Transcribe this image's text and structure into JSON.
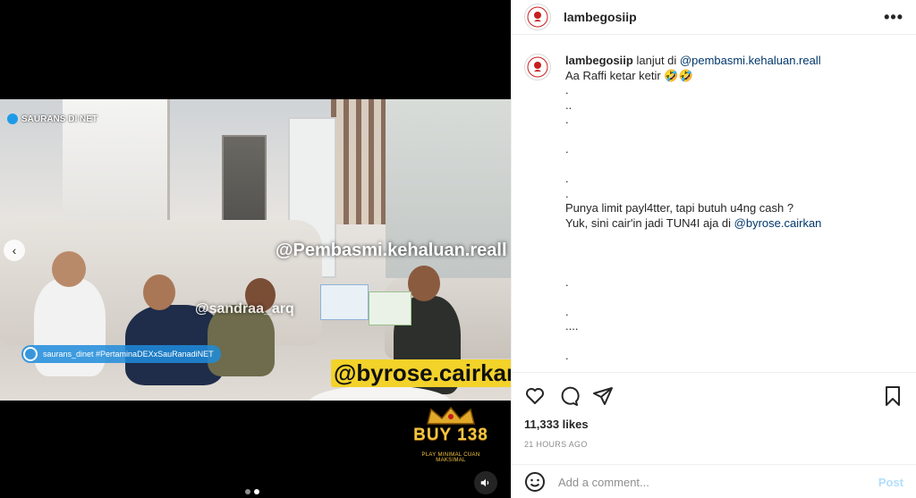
{
  "account": {
    "username": "lambegosiip",
    "more_label": "•••"
  },
  "media": {
    "video": {
      "channel_tag": "SAURANS DI NET",
      "ig_tag": "saurans_dinet #PertaminaDEXxSauRanadiNET",
      "watermark_main": "@Pembasmi.kehaluan.reall",
      "watermark_small": "@sandraa_arq",
      "watermark_promo": "@byrose.cairkan"
    },
    "ad": {
      "brand": "BUY 138",
      "tagline": "PLAY MINIMAL CUAN MAKSIMAL"
    },
    "prev_arrow": "‹",
    "carousel": {
      "count": 2,
      "active": 2
    }
  },
  "caption": {
    "username": "lambegosiip",
    "lines": [
      {
        "pre": "lanjut di ",
        "mention": "@pembasmi.kehaluan.reall",
        "post": ""
      },
      {
        "pre": "Aa Raffi ketar ketir 🤣🤣",
        "mention": "",
        "post": ""
      },
      {
        "pre": ".",
        "mention": "",
        "post": ""
      },
      {
        "pre": "..",
        "mention": "",
        "post": ""
      },
      {
        "pre": ".",
        "mention": "",
        "post": ""
      },
      {
        "pre": "",
        "mention": "",
        "post": ""
      },
      {
        "pre": ".",
        "mention": "",
        "post": ""
      },
      {
        "pre": "",
        "mention": "",
        "post": ""
      },
      {
        "pre": ".",
        "mention": "",
        "post": ""
      },
      {
        "pre": ".",
        "mention": "",
        "post": ""
      },
      {
        "pre": "Punya limit payl4tter, tapi butuh u4ng cash ?",
        "mention": "",
        "post": ""
      },
      {
        "pre": "Yuk, sini cair'in jadi TUN4I aja di ",
        "mention": "@byrose.cairkan",
        "post": ""
      },
      {
        "pre": "",
        "mention": "",
        "post": ""
      },
      {
        "pre": "",
        "mention": "",
        "post": ""
      },
      {
        "pre": "",
        "mention": "",
        "post": ""
      },
      {
        "pre": ".",
        "mention": "",
        "post": ""
      },
      {
        "pre": "",
        "mention": "",
        "post": ""
      },
      {
        "pre": ".",
        "mention": "",
        "post": ""
      },
      {
        "pre": "....",
        "mention": "",
        "post": ""
      },
      {
        "pre": "",
        "mention": "",
        "post": ""
      },
      {
        "pre": ".",
        "mention": "",
        "post": ""
      }
    ]
  },
  "stats": {
    "likes": "11,333 likes",
    "time": "21 HOURS AGO"
  },
  "comment": {
    "placeholder": "Add a comment...",
    "post_label": "Post"
  },
  "colors": {
    "link": "#00376b",
    "muted": "#8e8e8e",
    "post_disabled": "#b2dffc"
  },
  "icons": [
    "heart-icon",
    "comment-icon",
    "share-icon",
    "bookmark-icon",
    "emoji-icon",
    "sound-icon",
    "more-icon"
  ]
}
